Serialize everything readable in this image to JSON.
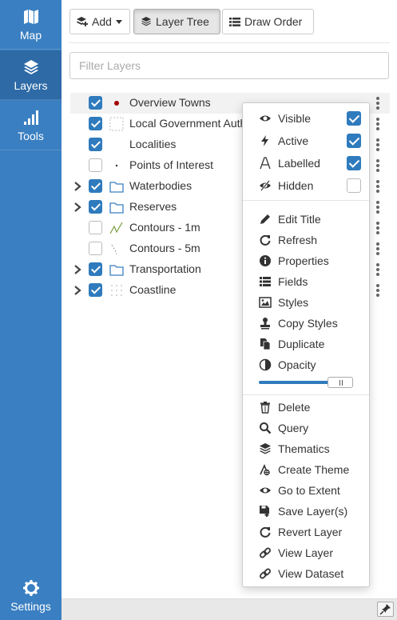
{
  "nav": {
    "items": [
      {
        "label": "Map",
        "icon": "map-icon"
      },
      {
        "label": "Layers",
        "icon": "layers-icon"
      },
      {
        "label": "Tools",
        "icon": "signal-bars-icon"
      }
    ],
    "active": "Layers",
    "settings_label": "Settings"
  },
  "toolbar": {
    "add_label": "Add",
    "layer_tree_label": "Layer Tree",
    "draw_order_label": "Draw Order",
    "active_tab": "Layer Tree"
  },
  "filter": {
    "placeholder": "Filter Layers",
    "value": ""
  },
  "layers": [
    {
      "name": "Overview Towns",
      "checked": true,
      "expandable": false,
      "symbol": "dot-red"
    },
    {
      "name": "Local Government Auth",
      "checked": true,
      "expandable": false,
      "symbol": "dashed-box"
    },
    {
      "name": "Localities",
      "checked": true,
      "expandable": false,
      "symbol": "none"
    },
    {
      "name": "Points of Interest",
      "checked": false,
      "expandable": false,
      "symbol": "small-dot"
    },
    {
      "name": "Waterbodies",
      "checked": true,
      "expandable": true,
      "symbol": "folder"
    },
    {
      "name": "Reserves",
      "checked": true,
      "expandable": true,
      "symbol": "folder"
    },
    {
      "name": "Contours - 1m",
      "checked": false,
      "expandable": false,
      "symbol": "line-green"
    },
    {
      "name": "Contours - 5m",
      "checked": false,
      "expandable": false,
      "symbol": "line-dashed"
    },
    {
      "name": "Transportation",
      "checked": true,
      "expandable": true,
      "symbol": "folder"
    },
    {
      "name": "Coastline",
      "checked": true,
      "expandable": true,
      "symbol": "dotted-grid"
    }
  ],
  "context_menu": {
    "toggles": [
      {
        "label": "Visible",
        "icon": "eye-icon",
        "checked": true
      },
      {
        "label": "Active",
        "icon": "bolt-icon",
        "checked": true
      },
      {
        "label": "Labelled",
        "icon": "font-icon",
        "checked": true
      },
      {
        "label": "Hidden",
        "icon": "eye-slash-icon",
        "checked": false
      }
    ],
    "actions_top": [
      {
        "label": "Edit Title",
        "icon": "pencil-icon"
      },
      {
        "label": "Refresh",
        "icon": "refresh-icon"
      },
      {
        "label": "Properties",
        "icon": "info-icon"
      },
      {
        "label": "Fields",
        "icon": "list-icon"
      },
      {
        "label": "Styles",
        "icon": "image-icon"
      },
      {
        "label": "Copy Styles",
        "icon": "stamp-icon"
      },
      {
        "label": "Duplicate",
        "icon": "copy-icon"
      },
      {
        "label": "Opacity",
        "icon": "contrast-icon"
      }
    ],
    "opacity": 0.9,
    "actions_bottom": [
      {
        "label": "Delete",
        "icon": "trash-icon"
      },
      {
        "label": "Query",
        "icon": "search-icon"
      },
      {
        "label": "Thematics",
        "icon": "layers-icon"
      },
      {
        "label": "Create Theme",
        "icon": "theme-icon"
      },
      {
        "label": "Go to Extent",
        "icon": "eye-icon"
      },
      {
        "label": "Save Layer(s)",
        "icon": "save-icon"
      },
      {
        "label": "Revert Layer",
        "icon": "refresh-icon"
      },
      {
        "label": "View Layer",
        "icon": "link-icon"
      },
      {
        "label": "View Dataset",
        "icon": "link-icon"
      }
    ]
  },
  "colors": {
    "sidebar": "#3a7fc1",
    "sidebar_active": "#2d6aa6",
    "checkbox": "#2f7bbd",
    "town_symbol": "#a00000",
    "contour_symbol": "#7aa040"
  }
}
